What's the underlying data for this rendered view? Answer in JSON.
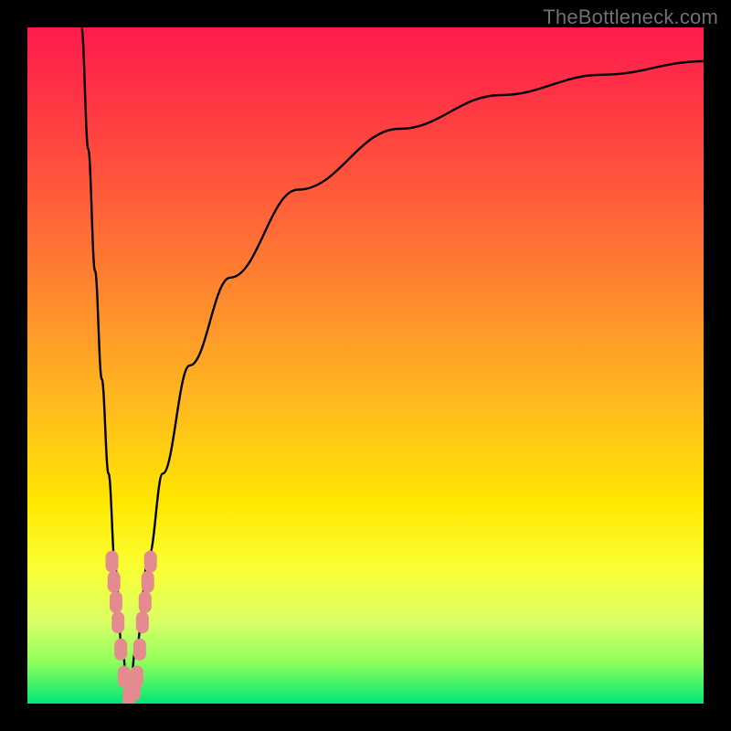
{
  "watermark": "TheBottleneck.com",
  "chart_data": {
    "type": "line",
    "title": "",
    "xlabel": "",
    "ylabel": "",
    "xlim": [
      0,
      100
    ],
    "ylim": [
      0,
      100
    ],
    "note": "Values are read off the plot in percentage of plot width/height; y measured from bottom (0 = bottom green, 100 = top red). The black curve is a V-shaped bottleneck curve: a steep falling branch on the left meeting a log-like rising branch on the right near x≈15.",
    "series": [
      {
        "name": "left-branch",
        "x": [
          8,
          9,
          10,
          11,
          12,
          13,
          14,
          15
        ],
        "y": [
          100,
          82,
          64,
          48,
          34,
          20,
          8,
          0
        ]
      },
      {
        "name": "right-branch",
        "x": [
          15,
          16,
          18,
          20,
          24,
          30,
          40,
          55,
          70,
          85,
          100
        ],
        "y": [
          0,
          8,
          22,
          34,
          50,
          63,
          76,
          85,
          90,
          93,
          95
        ]
      }
    ],
    "markers": {
      "name": "highlighted-points",
      "comment": "Pink pill-shaped markers clustered near the trough of the V.",
      "points": [
        {
          "x": 12.5,
          "y": 21
        },
        {
          "x": 12.8,
          "y": 18
        },
        {
          "x": 13.1,
          "y": 15
        },
        {
          "x": 13.4,
          "y": 12
        },
        {
          "x": 13.8,
          "y": 8
        },
        {
          "x": 14.3,
          "y": 4
        },
        {
          "x": 15.0,
          "y": 1
        },
        {
          "x": 15.8,
          "y": 2
        },
        {
          "x": 16.2,
          "y": 4
        },
        {
          "x": 16.6,
          "y": 8
        },
        {
          "x": 17.0,
          "y": 12
        },
        {
          "x": 17.4,
          "y": 15
        },
        {
          "x": 17.8,
          "y": 18
        },
        {
          "x": 18.2,
          "y": 21
        }
      ]
    },
    "gradient_bands": [
      {
        "color": "#ff1a4d",
        "stop": 0
      },
      {
        "color": "#ff8a2e",
        "stop": 40
      },
      {
        "color": "#ffe600",
        "stop": 70
      },
      {
        "color": "#00e676",
        "stop": 100
      }
    ]
  }
}
